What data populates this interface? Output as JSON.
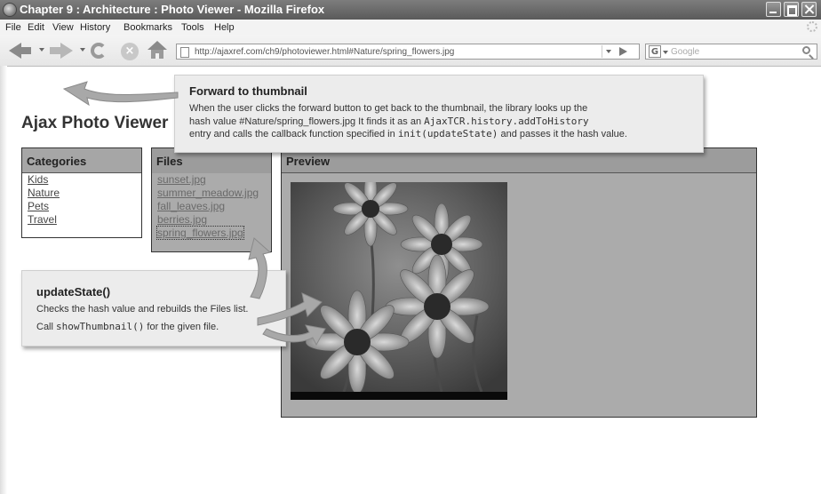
{
  "window": {
    "title": "Chapter 9 : Architecture : Photo Viewer - Mozilla Firefox"
  },
  "menu": {
    "items": [
      "File",
      "Edit",
      "View",
      "History",
      "Bookmarks",
      "Tools",
      "Help"
    ]
  },
  "toolbar": {
    "url": "http://ajaxref.com/ch9/photoviewer.html#Nature/spring_flowers.jpg",
    "search_engine_icon": "G",
    "search_placeholder": "Google"
  },
  "page": {
    "title": "Ajax Photo Viewer",
    "categories": {
      "header": "Categories",
      "items": [
        "Kids",
        "Nature",
        "Pets",
        "Travel"
      ]
    },
    "files": {
      "header": "Files",
      "items": [
        "sunset.jpg",
        "summer_meadow.jpg",
        "fall_leaves.jpg",
        "berries.jpg",
        "spring_flowers.jpg"
      ],
      "selected": "spring_flowers.jpg"
    },
    "preview": {
      "header": "Preview"
    }
  },
  "callouts": {
    "forward": {
      "title": "Forward to thumbnail",
      "line1": "When the user clicks the forward button to get back to the thumbnail, the library looks up the",
      "line2_a": "hash value #Nature/spring_flowers.jpg  It finds it as an ",
      "line2_code": "AjaxTCR.history.addToHistory",
      "line3_a": "entry and calls the callback function specified in ",
      "line3_code": "init(updateState)",
      "line3_b": " and passes it the hash value."
    },
    "update": {
      "title": "updateState()",
      "line1": "Checks the hash value and rebuilds the Files list.",
      "line2_a": "Call ",
      "line2_code": "showThumbnail()",
      "line2_b": " for the given file."
    }
  },
  "colors": {
    "title_bar": "#5a5a5a",
    "panel_header": "#9c9c9c",
    "panel_body": "#ababab",
    "callout_bg": "#ececec",
    "arrow": "#a8a8a8"
  }
}
